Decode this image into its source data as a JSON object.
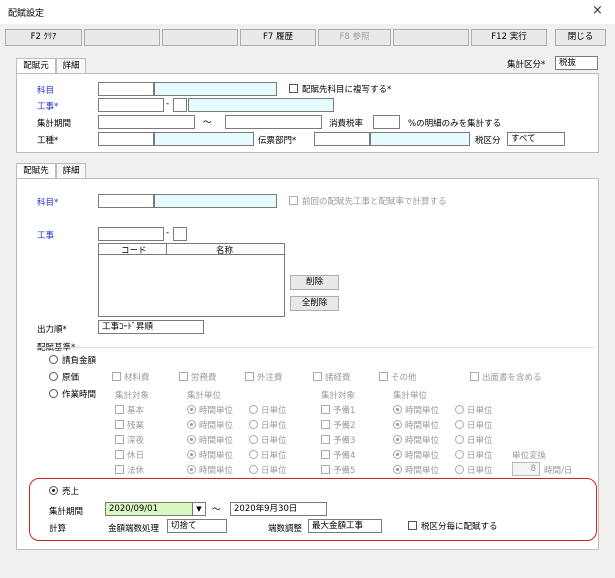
{
  "window": {
    "title": "配賦設定",
    "close": "×"
  },
  "fkeys": {
    "f2": "F2 ｸﾘｱ",
    "f7": "F7 履歴",
    "f8": "F8 参照",
    "f12": "F12 実行",
    "close": "閉じる"
  },
  "src": {
    "tab1": "配賦元",
    "tab2": "詳細",
    "total_div_label": "集計区分*",
    "total_div_value": "税抜",
    "subject_label": "科目",
    "copy_label": "配賦先科目に複写する*",
    "work_label": "工事*",
    "dash": "-",
    "period_label": "集計期間",
    "tilde": "～",
    "tax_rate_label": "消費税率",
    "tax_rate_suffix": "%の明細のみを集計する",
    "process_label": "工種*",
    "voucher_dept_label": "伝票部門*",
    "tax_div_label": "税区分",
    "tax_div_value": "すべて"
  },
  "dst": {
    "tab1": "配賦先",
    "tab2": "詳細",
    "subject_label": "科目*",
    "prev_rate_label": "前回の配賦先工事と配賦率で計算する",
    "work_label": "工事",
    "dash": "-",
    "col_code": "コード",
    "col_name": "名称",
    "delete_btn": "削除",
    "delete_all_btn": "全削除",
    "order_label": "出力順*",
    "order_value": "工事ｺｰﾄﾞ昇順",
    "basis_label": "配賦基準*",
    "opt_contract": "請負金額",
    "opt_cost": "原価",
    "opt_hours": "作業時間",
    "cost_items": [
      "材料費",
      "労務費",
      "外注費",
      "諸経費",
      "その他"
    ],
    "include_invoice": "出面書を含める",
    "hdr_target": "集計対象",
    "hdr_unit": "集計単位",
    "left_rows": [
      "基本",
      "残業",
      "深夜",
      "休日",
      "法休"
    ],
    "right_rows": [
      "予備1",
      "予備2",
      "予備3",
      "予備4",
      "予備5"
    ],
    "unit_hour": "時間単位",
    "unit_day": "日単位",
    "conv_label": "単位変換",
    "conv_value": "8",
    "conv_suffix": "時間/日"
  },
  "sales": {
    "label": "売上",
    "period_label": "集計期間",
    "from": "2020/09/01",
    "to": "2020年9月30日",
    "tilde": "～",
    "calc_label": "計算",
    "round_label": "金額端数処理",
    "round_value": "切捨て",
    "adjust_label": "端数調整",
    "adjust_value": "最大金額工事",
    "per_tax_label": "税区分毎に配賦する"
  }
}
